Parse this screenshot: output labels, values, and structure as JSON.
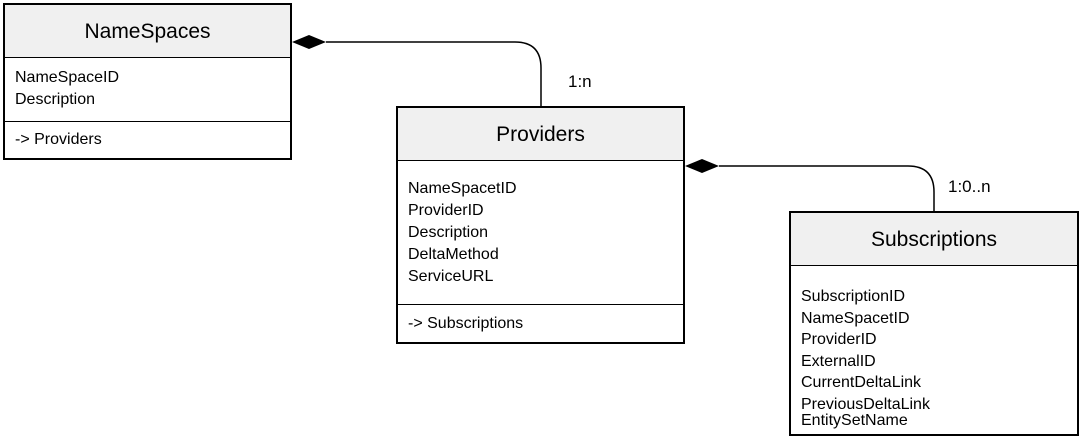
{
  "entities": {
    "namespaces": {
      "title": "NameSpaces",
      "attributes": [
        "NameSpaceID",
        "Description"
      ],
      "methods": [
        "-> Providers"
      ]
    },
    "providers": {
      "title": "Providers",
      "attributes": [
        "NameSpacetID",
        "ProviderID",
        "Description",
        "DeltaMethod",
        "ServiceURL"
      ],
      "methods": [
        "-> Subscriptions"
      ]
    },
    "subscriptions": {
      "title": "Subscriptions",
      "attributes": [
        "SubscriptionID",
        "NameSpacetID",
        "ProviderID",
        "ExternalID",
        "CurrentDeltaLink",
        "PreviousDeltaLink",
        "EntitySetName"
      ],
      "methods": []
    }
  },
  "relations": [
    {
      "from": "NameSpaces",
      "to": "Providers",
      "multiplicity": "1:n",
      "kind": "composition"
    },
    {
      "from": "Providers",
      "to": "Subscriptions",
      "multiplicity": "1:0..n",
      "kind": "composition"
    }
  ]
}
